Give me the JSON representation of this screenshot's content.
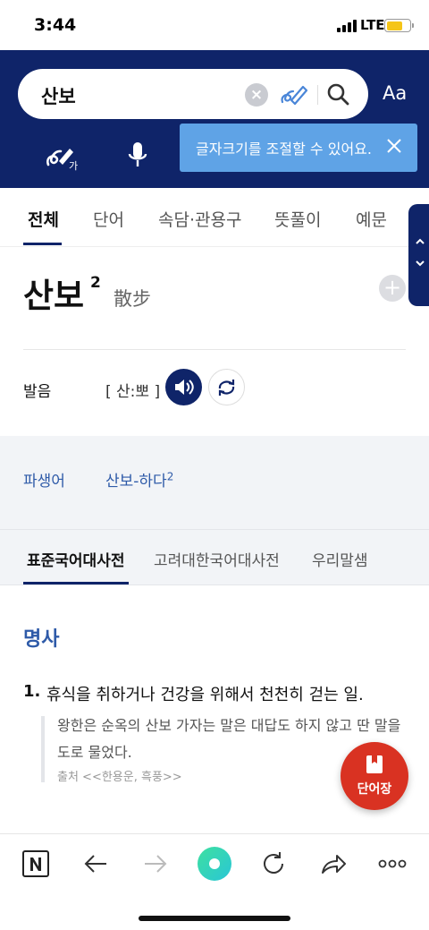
{
  "status_bar": {
    "time": "3:44",
    "network": "LTE"
  },
  "search": {
    "query": "산보"
  },
  "header": {
    "font_size_button": "Aa"
  },
  "tooltip": {
    "text": "글자크기를 조절할 수 있어요."
  },
  "tabs": [
    {
      "label": "전체",
      "active": true
    },
    {
      "label": "단어"
    },
    {
      "label": "속담·관용구"
    },
    {
      "label": "뜻풀이"
    },
    {
      "label": "예문"
    }
  ],
  "entry": {
    "word": "산보",
    "homograph_number": "2",
    "hanja": "散步",
    "pronunciation_label": "발음",
    "pronunciation": "[ 산:뽀 ]"
  },
  "derivatives": {
    "label": "파생어",
    "word": "산보-하다",
    "word_sup": "2"
  },
  "dictionary_tabs": [
    {
      "label": "표준국어대사전",
      "active": true
    },
    {
      "label": "고려대한국어대사전"
    },
    {
      "label": "우리말샘"
    }
  ],
  "definition": {
    "part_of_speech": "명사",
    "number": "1.",
    "text": "휴식을 취하거나 건강을 위해서 천천히 걷는 일.",
    "example": "왕한은 순옥의 산보 가자는 말은 대답도 하지 않고 딴 말을 도로 물었다.",
    "source": "출처 <<한용운, 흑풍>>"
  },
  "wordbook_button": {
    "label": "단어장"
  },
  "colors": {
    "header": "#0f2469",
    "accent_blue": "#2e5aa8",
    "tooltip": "#5fa3e6",
    "wordbook": "#d93222"
  }
}
